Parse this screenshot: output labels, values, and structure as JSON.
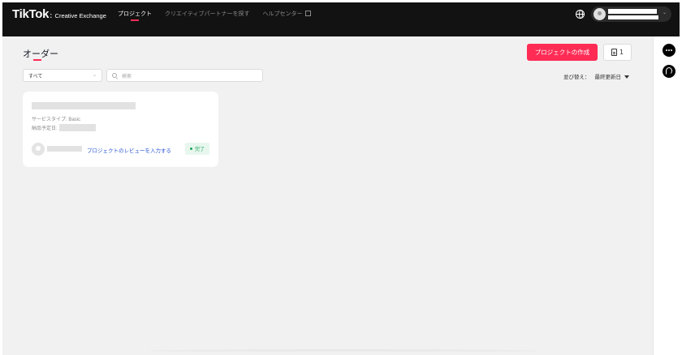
{
  "header": {
    "logo_main": "TikTok",
    "logo_sub": "Creative Exchange",
    "nav": [
      {
        "label": "プロジェクト",
        "active": true
      },
      {
        "label": "クリエイティブパートナーを探す",
        "active": false
      },
      {
        "label": "ヘルプセンター",
        "active": false
      }
    ],
    "icons": {
      "language": "globe-icon",
      "external": "external-link-icon",
      "profile_menu": "chevron-down-icon"
    },
    "profile_chevron": "⌄"
  },
  "page": {
    "title": "オーダー",
    "create_button": "プロジェクトの作成",
    "doc_count": "1",
    "accent_color": "#fe2c55"
  },
  "filters": {
    "select_value": "すべて",
    "select_chevron": "⌄",
    "search_placeholder": "検索",
    "sort_label": "並び替え：",
    "sort_value": "最終更新日"
  },
  "orders": [
    {
      "service_type": "サービスタイプ: Basic",
      "due_date_label": "納品予定日:",
      "review_link": "プロジェクトのレビューを入力する",
      "status": "完了",
      "status_color": "#1ba55a"
    }
  ],
  "sidebar": {
    "icons": [
      "chat-icon",
      "support-icon"
    ]
  }
}
